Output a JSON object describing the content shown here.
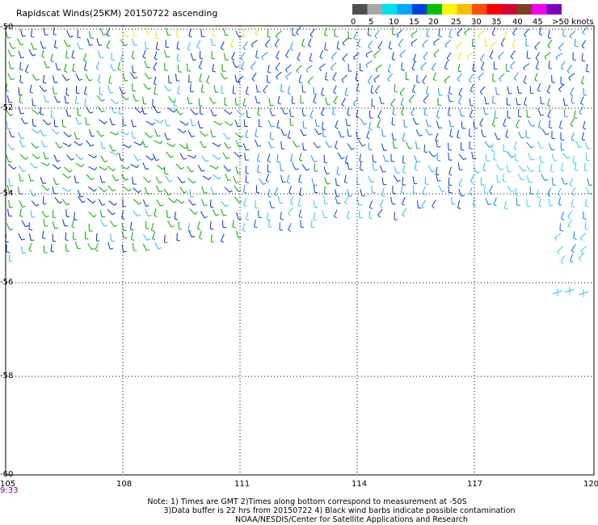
{
  "title": "Rapidscat Winds(25KM) 20150722 ascending",
  "legend": {
    "labels": [
      "0",
      "5",
      "10",
      "15",
      "20",
      "25",
      "30",
      "35",
      "40",
      "45",
      ">50 knots"
    ],
    "colors": [
      "#505050",
      "#a8a8a8",
      "#00e0f0",
      "#00a8f8",
      "#0040e0",
      "#00c000",
      "#f8f800",
      "#f8c000",
      "#f85000",
      "#f80000",
      "#d80030",
      "#804020",
      "#f000f0",
      "#8000c0"
    ]
  },
  "axes": {
    "lat_labels": [
      "-50",
      "-52",
      "-54",
      "-56",
      "-58",
      "-60"
    ],
    "lon_labels": [
      "105",
      "108",
      "111",
      "114",
      "117",
      "120"
    ]
  },
  "time_label": "9:33",
  "notes": {
    "line1": "Note: 1) Times are GMT 2)Times along bottom correspond to measurement at -50S",
    "line2": "3)Data buffer is 22 hrs from 20150722 4) Black wind barbs indicate possible contamination",
    "line3": "NOAA/NESDIS/Center for Satellite Applications and Research"
  }
}
